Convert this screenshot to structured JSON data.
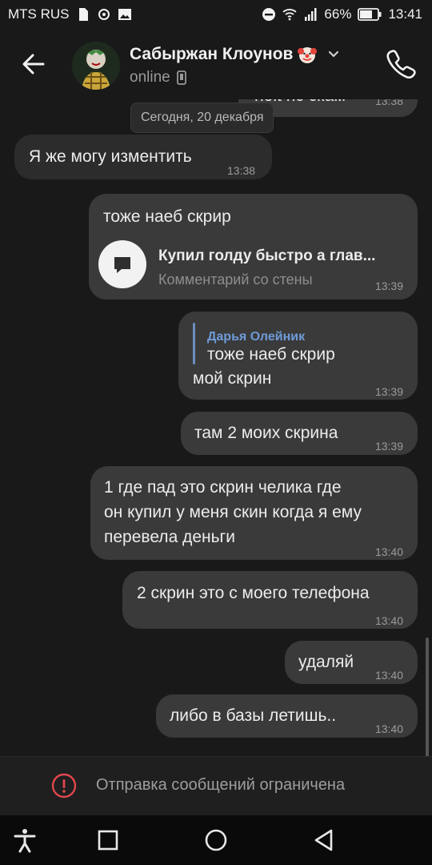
{
  "status_bar": {
    "carrier": "MTS RUS",
    "battery": "66%",
    "time": "13:41"
  },
  "header": {
    "contact_name": "Сабыржан Клоунов",
    "status": "online"
  },
  "chat": {
    "cut_message": {
      "text": "nolt нс скам",
      "time": "13:38"
    },
    "date_separator": "Сегодня, 20 декабря",
    "messages": [
      {
        "text": "Я же могу изментить",
        "time": "13:38"
      },
      {
        "text": "тоже наеб скрир",
        "attachment_title": "Купил голду быстро а глав...",
        "attachment_sub": "Комментарий со стены",
        "time": "13:39"
      },
      {
        "reply_name": "Дарья Олейник",
        "reply_text": "тоже наеб скрир",
        "text": "мой скрин",
        "time": "13:39"
      },
      {
        "text": "там 2 моих скрина",
        "time": "13:39"
      },
      {
        "lines": [
          "1 где пад это скрин челика где",
          "он купил у меня скин когда я ему",
          "перевела деньги"
        ],
        "time": "13:40"
      },
      {
        "text": "2 скрин это с моего телефона",
        "time": "13:40"
      },
      {
        "text": "удаляй",
        "time": "13:40"
      },
      {
        "text": "либо в базы летишь..",
        "time": "13:40"
      }
    ]
  },
  "restriction": {
    "text": "Отправка сообщений ограничена"
  },
  "icons": {
    "back": "arrow-left-icon",
    "phone": "phone-icon",
    "clown": "clown-emoji-icon",
    "chevron": "chevron-down-icon",
    "device": "mobile-device-icon",
    "comment": "comment-icon",
    "warning": "warning-icon",
    "accessibility": "accessibility-icon",
    "recents": "square-icon",
    "home": "circle-icon",
    "nav_back": "triangle-back-icon"
  },
  "colors": {
    "background": "#191919",
    "bubble_out": "#3a3a3a",
    "bubble_in": "#2c2c2c",
    "reply_accent": "#6f9bd8",
    "warning": "#e0474c"
  }
}
